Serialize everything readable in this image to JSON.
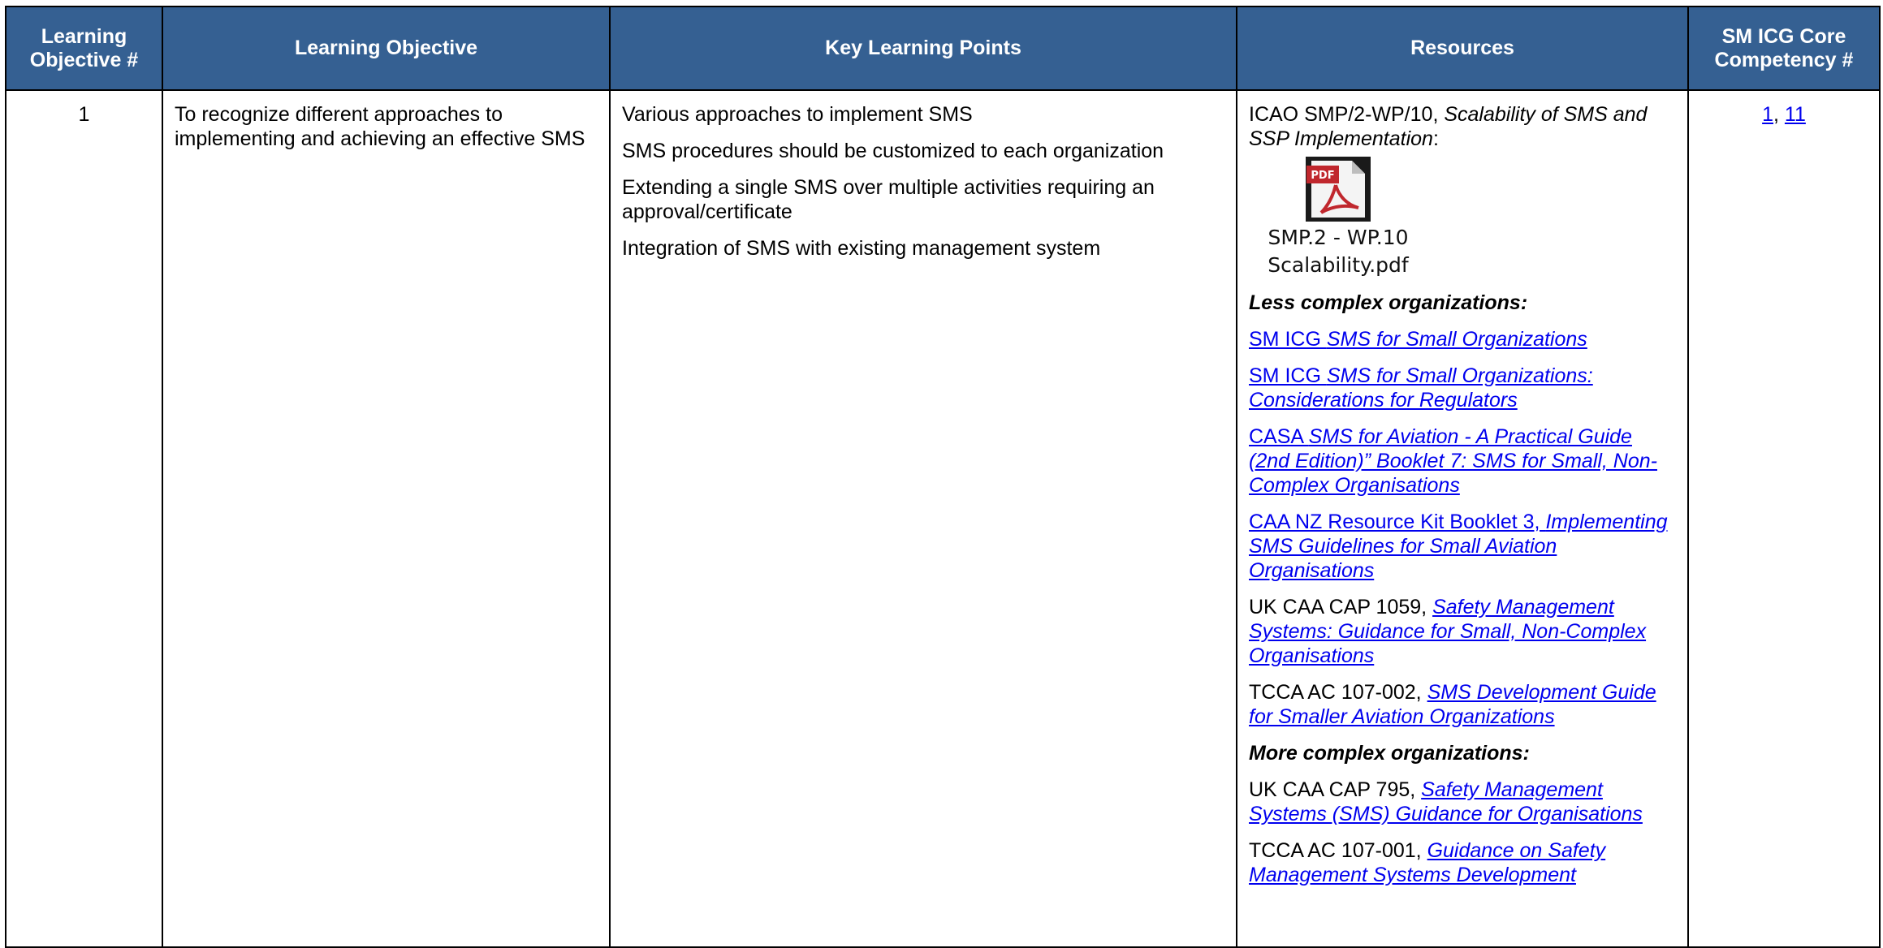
{
  "table": {
    "headers": {
      "objective_num": "Learning Objective #",
      "objective": "Learning Objective",
      "key_points": "Key Learning Points",
      "resources": "Resources",
      "competency": "SM ICG Core Competency #"
    },
    "row": {
      "num": "1",
      "objective": "To recognize different approaches to implementing and achieving an effective SMS",
      "key_points": [
        "Various approaches to implement SMS",
        "SMS procedures should be customized to each organization",
        "Extending a single SMS over multiple activities requiring an approval/certificate",
        "Integration of SMS with existing management system"
      ],
      "resources": {
        "icao_prefix": "ICAO SMP/2-WP/10, ",
        "icao_title": "Scalability of SMS and SSP Implementation",
        "icao_suffix": ":",
        "attachment": {
          "icon": "pdf-file-icon",
          "caption_line1": "SMP.2 - WP.10",
          "caption_line2": "Scalability.pdf"
        },
        "less_complex_heading": "Less complex organizations:",
        "link1_prefix": "SM ICG ",
        "link1_title": "SMS for Small Organizations",
        "link2_prefix": "SM ICG ",
        "link2_title": "SMS for Small Organizations: Considerations for Regulators",
        "link3_prefix": "CASA ",
        "link3_title": "SMS for Aviation - A Practical Guide (2nd Edition)” Booklet 7: SMS for Small, Non-Complex Organisations",
        "link4_prefix": "CAA NZ Resource Kit Booklet 3, ",
        "link4_title": "Implementing SMS Guidelines for Small Aviation Organisations",
        "item5_prefix": "UK CAA CAP 1059, ",
        "item5_link": "Safety Management Systems: Guidance for Small, Non-Complex Organisations",
        "item6_prefix": "TCCA AC 107-002, ",
        "item6_link": "SMS Development Guide for Smaller Aviation Organizations",
        "more_complex_heading": "More complex organizations:",
        "item7_prefix": "UK CAA CAP 795, ",
        "item7_link": "Safety Management Systems (SMS) Guidance for Organisations",
        "item8_prefix": "TCCA AC 107-001, ",
        "item8_link": "Guidance on Safety Management Systems Development"
      },
      "competency": {
        "link1": "1",
        "separator": ", ",
        "link2": "11"
      }
    }
  },
  "colors": {
    "header_bg": "#356092",
    "header_text": "#ffffff",
    "link": "#0000ee",
    "border": "#000000"
  }
}
